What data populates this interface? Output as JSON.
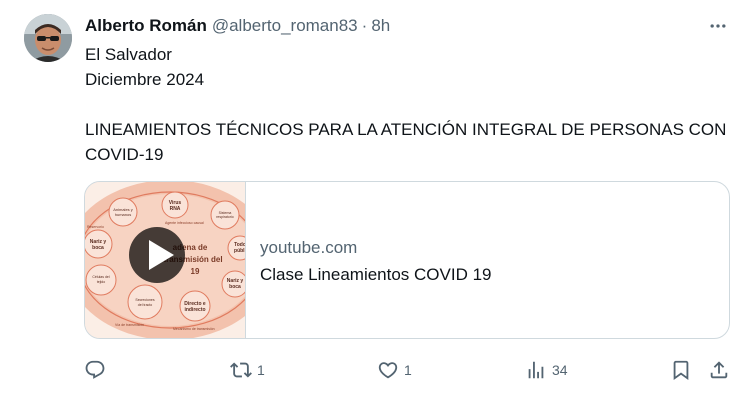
{
  "author": {
    "name": "Alberto Román",
    "handle": "@alberto_roman83",
    "separator": "·",
    "time": "8h"
  },
  "post": {
    "line1": "El Salvador",
    "line2": "Diciembre 2024",
    "line3": "LINEAMIENTOS TÉCNICOS PARA LA ATENCIÓN INTEGRAL DE PERSONAS CON COVID-19"
  },
  "card": {
    "domain": "youtube.com",
    "title": "Clase Lineamientos COVID 19",
    "thumbnail": {
      "nodes": [
        "Virus RNA",
        "Animales y humanos",
        "Nariz y boca",
        "Células del tejido respiratorio",
        "Secreciones del tracto respiratorio",
        "Directo e indirecto",
        "Nariz y boca",
        "Todo público",
        "Sistema respiratorio y otros"
      ],
      "labels": [
        "Reservorio",
        "Agente infeccioso causal",
        "Vía de transmisión",
        "Mecanismo de transmisión"
      ],
      "center": [
        "Cadena de",
        "transmisión del",
        "COVID-19"
      ]
    }
  },
  "actions": {
    "reply_count": "",
    "repost_count": "1",
    "like_count": "1",
    "views_count": "34"
  },
  "icons": {
    "more": "more-horizontal-icon",
    "reply": "reply-icon",
    "repost": "repost-icon",
    "like": "heart-icon",
    "views": "views-icon",
    "bookmark": "bookmark-icon",
    "share": "share-icon",
    "play": "play-icon"
  },
  "colors": {
    "text_primary": "#0f1419",
    "text_secondary": "#536471",
    "border": "#cfd9de"
  }
}
